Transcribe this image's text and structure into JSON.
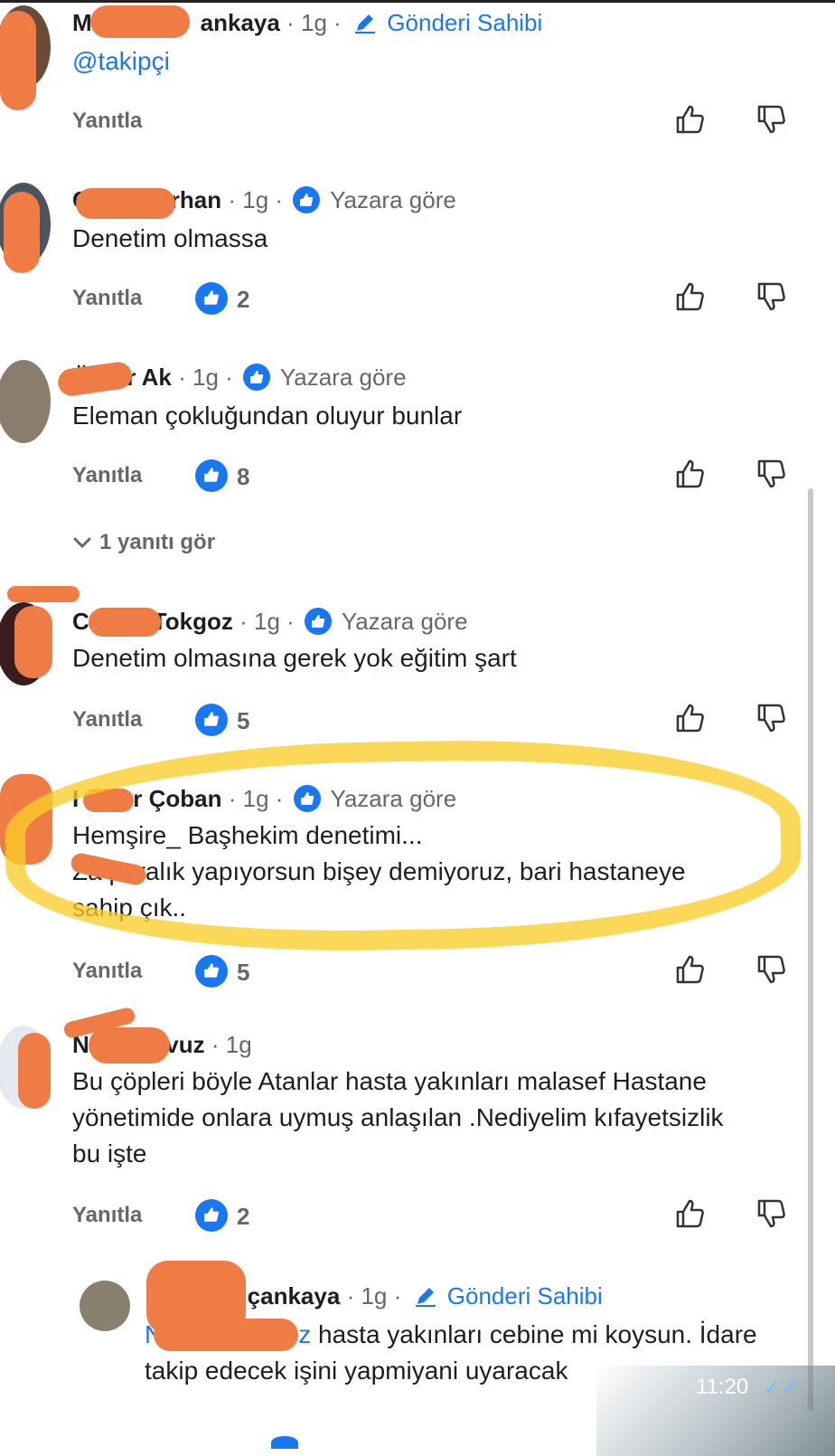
{
  "labels": {
    "reply": "Yanıtla",
    "post_owner": "Gönderi Sahibi",
    "by_author": "Yazara göre",
    "sep": "·"
  },
  "colors": {
    "accent": "#1877f2",
    "meta": "#65676b",
    "redaction": "#f07c45",
    "highlight": "#facd28"
  },
  "comments": [
    {
      "name_prefix": "M",
      "name_suffix": "ankaya",
      "age": "1g",
      "tag": "owner",
      "mention": "@takipçi",
      "text": "",
      "likes": ""
    },
    {
      "name_prefix": "C",
      "name_suffix": "rhan",
      "age": "1g",
      "tag": "author",
      "text": "Denetim olmassa",
      "likes": "2"
    },
    {
      "name_prefix": "Ö",
      "name_suffix": "r Ak",
      "age": "1g",
      "tag": "author",
      "text": "Eleman çokluğundan oluyur bunlar",
      "likes": "8"
    },
    {
      "name_prefix": "C",
      "name_suffix": "Tokgoz",
      "age": "1g",
      "tag": "author",
      "text": "Denetim olmasına gerek yok eğitim şart",
      "likes": "5"
    },
    {
      "name_prefix": "I",
      "name_suffix": "r Çoban",
      "age": "1g",
      "tag": "author",
      "text_line1": "Hemşire_ Başhekim  denetimi...",
      "text_line2": "Za    paralık yapıyorsun bişey demiyoruz, bari hastaneye",
      "text_line3": "sahip çık..",
      "likes": "5"
    },
    {
      "name_prefix": "N",
      "name_suffix": "avuz",
      "age": "1g",
      "tag": "",
      "text_line1": "Bu çöpleri böyle Atanlar hasta yakınları malasef Hastane",
      "text_line2": "yönetimide onlara uymuş anlaşılan .Nediyelim kıfayetsizlik",
      "text_line3": "bu işte",
      "likes": "2"
    }
  ],
  "view_replies": "1 yanıtı gör",
  "nested_reply": {
    "name_prefix": "M",
    "name_suffix": "çankaya",
    "age": "1g",
    "mention_prefix": "N",
    "mention_suffix": "z",
    "text_line1": "hasta yakınları cebine mi koysun. İdare",
    "text_line2": "takip edecek işini yapmiyani uyaracak"
  },
  "status_time": "11:20",
  "status_ticks": "✓✓"
}
